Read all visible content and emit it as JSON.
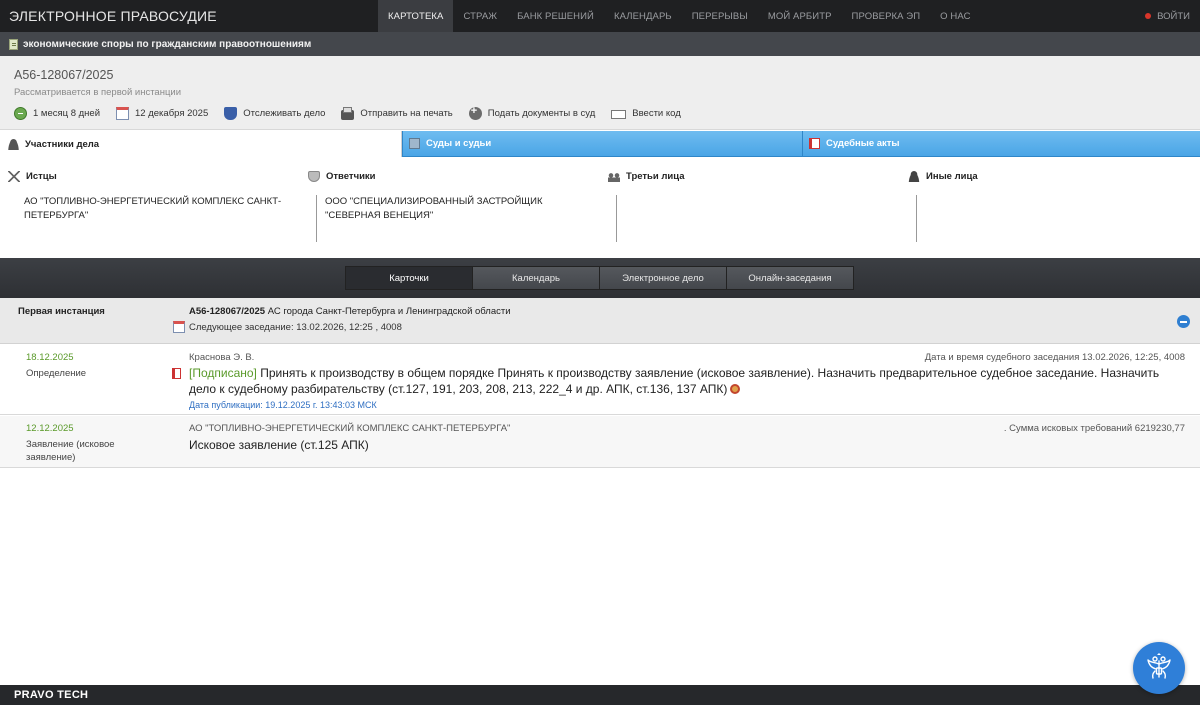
{
  "brand": "ЭЛЕКТРОННОЕ ПРАВОСУДИЕ",
  "nav": [
    "КАРТОТЕКА",
    "СТРАЖ",
    "БАНК РЕШЕНИЙ",
    "КАЛЕНДАРЬ",
    "ПЕРЕРЫВЫ",
    "МОЙ АРБИТР",
    "ПРОВЕРКА ЭП",
    "О НАС"
  ],
  "login": "ВОЙТИ",
  "category": "экономические споры по гражданским правоотношениям",
  "case": {
    "number": "А56-128067/2025",
    "status": "Рассматривается в первой инстанции",
    "actions": {
      "duration": "1 месяц 8 дней",
      "date": "12 декабря 2025",
      "track": "Отслеживать дело",
      "print": "Отправить на печать",
      "submit": "Подать документы в суд",
      "code": "Ввести код"
    }
  },
  "tabs": {
    "participants": "Участники дела",
    "courts": "Суды и судьи",
    "acts": "Судебные акты"
  },
  "parties": {
    "plaintiffs": {
      "title": "Истцы",
      "text": "АО \"ТОПЛИВНО-ЭНЕРГЕТИЧЕСКИЙ КОМПЛЕКС САНКТ-ПЕТЕРБУРГА\""
    },
    "defendants": {
      "title": "Ответчики",
      "text": "ООО \"СПЕЦИАЛИЗИРОВАННЫЙ ЗАСТРОЙЩИК \"СЕВЕРНАЯ ВЕНЕЦИЯ\""
    },
    "third": {
      "title": "Третьи лица",
      "text": ""
    },
    "other": {
      "title": "Иные лица",
      "text": ""
    }
  },
  "subtabs": [
    "Карточки",
    "Календарь",
    "Электронное дело",
    "Онлайн-заседания"
  ],
  "instance": {
    "label": "Первая инстанция",
    "case_bold": "А56-128067/2025",
    "court": " АС города Санкт-Петербурга и Ленинградской области",
    "next": "Следующее заседание: 13.02.2026, 12:25 , 4008"
  },
  "entries": [
    {
      "date": "18.12.2025",
      "type": "Определение",
      "author": "Краснова Э. В.",
      "right": "Дата и время судебного заседания 13.02.2026, 12:25, 4008",
      "signed": "[Подписано]",
      "text": " Принять к производству в общем порядке Принять к производству заявление (исковое заявление). Назначить предварительное судебное заседание. Назначить дело к судебному разбирательству (ст.127, 191, 203, 208, 213, 222_4 и др. АПК, ст.136, 137 АПК)",
      "published": "Дата публикации: 19.12.2025 г. 13:43:03 МСК"
    },
    {
      "date": "12.12.2025",
      "type": "Заявление (исковое заявление)",
      "author": "АО \"ТОПЛИВНО-ЭНЕРГЕТИЧЕСКИЙ КОМПЛЕКС САНКТ-ПЕТЕРБУРГА\"",
      "right": ". Сумма исковых требований 6219230,77",
      "text": "Исковое заявление (ст.125 АПК)"
    }
  ],
  "footer": "PRAVO TECH",
  "colors": {
    "nav_bg": "#1f2022",
    "tab_blue": "#4aa5e6",
    "date_green": "#5a9a2a",
    "link_blue": "#2f6fc2",
    "emblem": "#2f7fd8"
  }
}
